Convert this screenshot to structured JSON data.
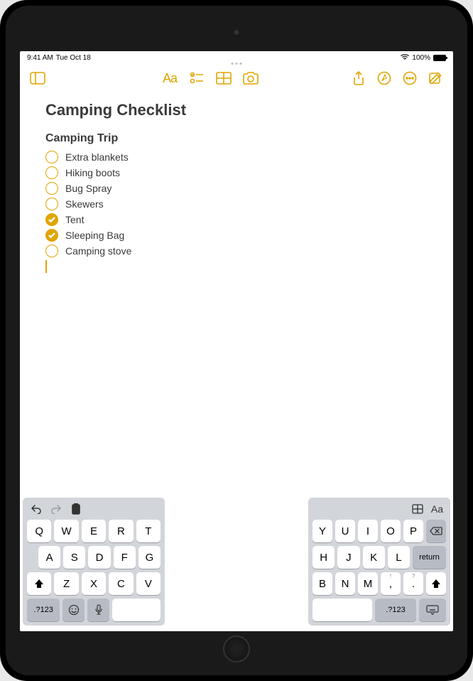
{
  "status": {
    "time": "9:41 AM",
    "date": "Tue Oct 18",
    "battery_pct": "100%"
  },
  "toolbar": {
    "aa": "Aa"
  },
  "note": {
    "title": "Camping Checklist",
    "heading": "Camping Trip",
    "items": [
      {
        "label": "Extra blankets",
        "checked": false
      },
      {
        "label": "Hiking boots",
        "checked": false
      },
      {
        "label": "Bug Spray",
        "checked": false
      },
      {
        "label": "Skewers",
        "checked": false
      },
      {
        "label": "Tent",
        "checked": true
      },
      {
        "label": "Sleeping Bag",
        "checked": true
      },
      {
        "label": "Camping stove",
        "checked": false
      }
    ]
  },
  "keyboard": {
    "left": {
      "row1": [
        "Q",
        "W",
        "E",
        "R",
        "T"
      ],
      "row2": [
        "A",
        "S",
        "D",
        "F",
        "G"
      ],
      "row3_shift": "⬆",
      "row3": [
        "Z",
        "X",
        "C",
        "V"
      ],
      "numkey": ".?123"
    },
    "right": {
      "aa": "Aa",
      "row1": [
        "Y",
        "U",
        "I",
        "O",
        "P"
      ],
      "row2": [
        "H",
        "J",
        "K",
        "L"
      ],
      "return": "return",
      "row3": [
        "B",
        "N",
        "M"
      ],
      "row3_punct": [
        {
          "main": ",",
          "sub": "!"
        },
        {
          "main": ".",
          "sub": "?"
        }
      ],
      "numkey": ".?123"
    }
  }
}
